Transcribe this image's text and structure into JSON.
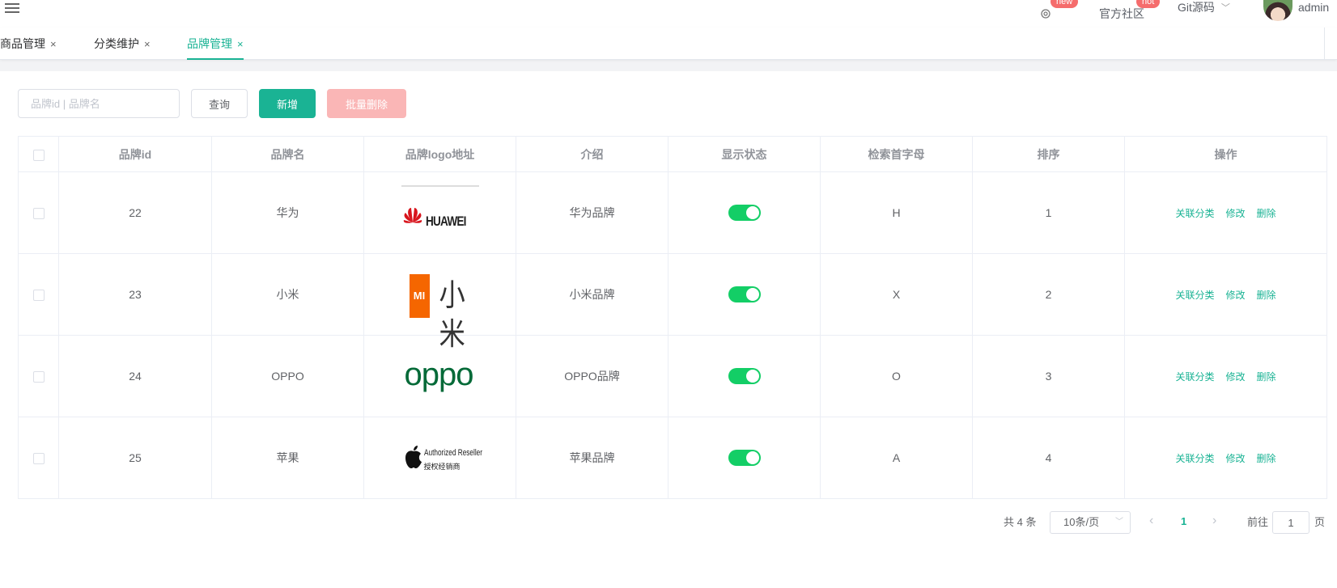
{
  "navbar": {
    "new_badge": "new",
    "community": "官方社区",
    "hot_badge": "hot",
    "git_source": "Git源码",
    "username": "admin"
  },
  "tabs": [
    {
      "label": "商品管理",
      "close": "×"
    },
    {
      "label": "分类维护",
      "close": "×"
    },
    {
      "label": "品牌管理",
      "close": "×",
      "active": true
    }
  ],
  "toolbar": {
    "search_placeholder": "品牌id | 品牌名",
    "query_label": "查询",
    "add_label": "新增",
    "batch_delete_label": "批量删除"
  },
  "table": {
    "columns": [
      "品牌id",
      "品牌名",
      "品牌logo地址",
      "介绍",
      "显示状态",
      "检索首字母",
      "排序",
      "操作"
    ],
    "rows": [
      {
        "id": "22",
        "name": "华为",
        "logo": "HUAWEI",
        "intro": "华为品牌",
        "show_status": true,
        "first_letter": "H",
        "sort": "1"
      },
      {
        "id": "23",
        "name": "小米",
        "logo": "小米",
        "intro": "小米品牌",
        "show_status": true,
        "first_letter": "X",
        "sort": "2"
      },
      {
        "id": "24",
        "name": "OPPO",
        "logo": "oppo",
        "intro": "OPPO品牌",
        "show_status": true,
        "first_letter": "O",
        "sort": "3"
      },
      {
        "id": "25",
        "name": "苹果",
        "logo": "Authorized Reseller",
        "logo_sub": "授权经销商",
        "intro": "苹果品牌",
        "show_status": true,
        "first_letter": "A",
        "sort": "4"
      }
    ],
    "actions": {
      "relate": "关联分类",
      "edit": "修改",
      "delete": "删除"
    }
  },
  "pagination": {
    "total": "共 4 条",
    "page_size": "10条/页",
    "current_page": "1",
    "goto_prefix": "前往",
    "goto_value": "1",
    "goto_suffix": "页"
  },
  "colors": {
    "primary": "#1ab394",
    "switch_on": "#13ce66",
    "danger_disabled": "#fab6b6"
  }
}
